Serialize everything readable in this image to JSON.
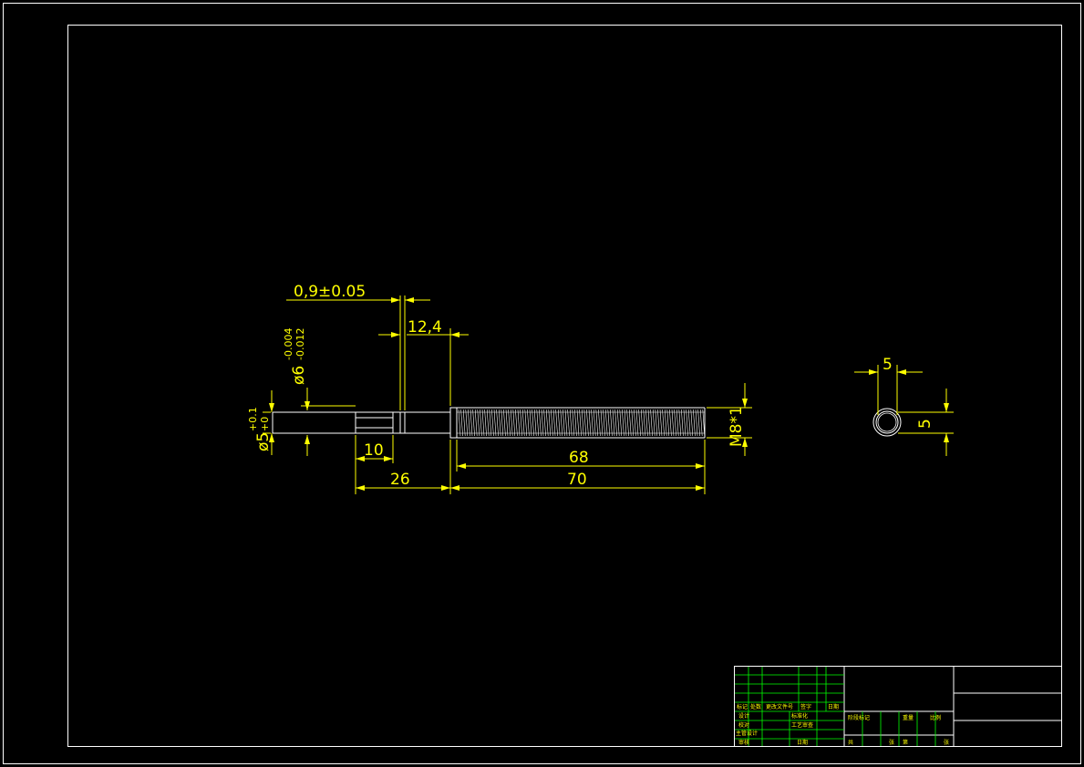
{
  "colors": {
    "background": "#000000",
    "outline": "#ffffff",
    "dimension": "#ffff00",
    "titleblock_grid": "#00ff00"
  },
  "dimensions": {
    "groove_width": "0,9±0.05",
    "head_offset": "12,4",
    "shank_dia_symbol": "ø6",
    "shank_dia_upper": "-0.004",
    "shank_dia_lower": "-0.012",
    "tip_dia_symbol": "ø5",
    "tip_dia_upper": "+0.1",
    "tip_dia_lower": "+0",
    "slot_length": "10",
    "shank_length": "26",
    "thread_length": "68",
    "total_thread_length": "70",
    "thread_spec": "M8*1",
    "end_view_width": "5",
    "end_view_height": "5"
  },
  "title_block": {
    "sign_row": [
      "标记",
      "处数",
      "更改文件号",
      "签字",
      "日期"
    ],
    "left_rows": [
      [
        "设计",
        "标准化"
      ],
      [
        "校对",
        "工艺审查"
      ],
      [
        "主管设计",
        ""
      ],
      [
        "审核",
        "日期"
      ]
    ],
    "stage_row": [
      "阶段标记",
      "重量",
      "比例"
    ],
    "sheet_row": [
      "共",
      "张",
      "第",
      "张"
    ]
  }
}
